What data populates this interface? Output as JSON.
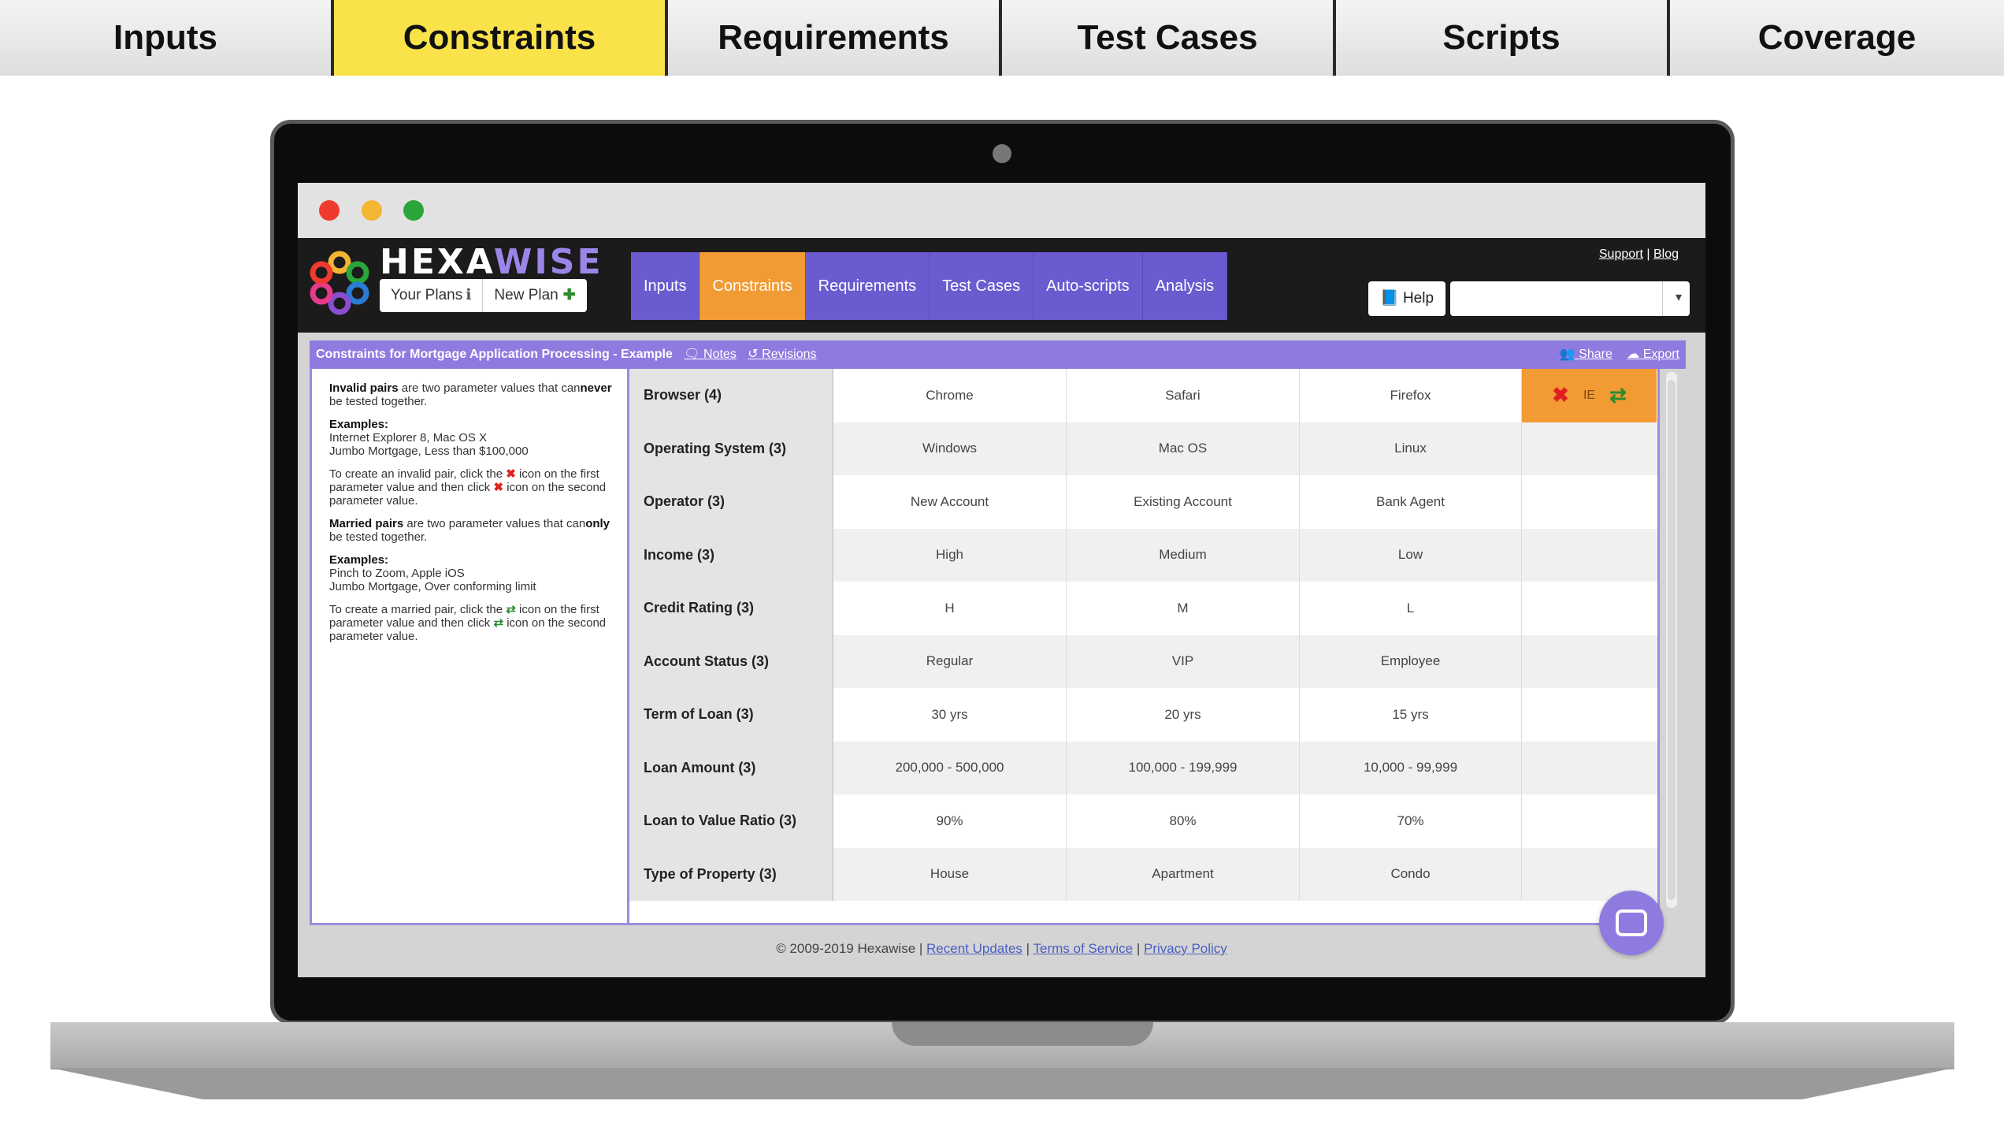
{
  "top_tabs": [
    {
      "label": "Inputs",
      "active": false
    },
    {
      "label": "Constraints",
      "active": true
    },
    {
      "label": "Requirements",
      "active": false
    },
    {
      "label": "Test Cases",
      "active": false
    },
    {
      "label": "Scripts",
      "active": false
    },
    {
      "label": "Coverage",
      "active": false
    }
  ],
  "app": {
    "brand_hexa": "HEXA",
    "brand_wise": "WISE",
    "your_plans": "Your Plans",
    "new_plan": "New Plan",
    "nav": [
      "Inputs",
      "Constraints",
      "Requirements",
      "Test Cases",
      "Auto-scripts",
      "Analysis"
    ],
    "support": "Support",
    "blog": "Blog",
    "help": "Help",
    "accent": "#6b5bd0",
    "active_color": "#f29a34"
  },
  "page": {
    "title": "Constraints for Mortgage Application Processing - Example",
    "notes": "Notes",
    "revisions": "Revisions",
    "share": "Share",
    "export": "Export"
  },
  "help_panel": {
    "invalid_bold": "Invalid pairs",
    "invalid_rest": "are two parameter values that can",
    "invalid_never": "never",
    "invalid_end": "be tested together.",
    "examples_label": "Examples:",
    "invalid_ex1": "Internet Explorer 8, Mac OS X",
    "invalid_ex2": "Jumbo Mortgage, Less than $100,000",
    "invalid_how1": "To create an invalid pair, click the",
    "invalid_how2": "icon on the first parameter value and then click",
    "invalid_how3": "icon on the second parameter value.",
    "married_bold": "Married pairs",
    "married_rest": "are two parameter values that can",
    "married_only": "only",
    "married_end": "be tested together.",
    "married_ex1": "Pinch to Zoom, Apple iOS",
    "married_ex2": "Jumbo Mortgage, Over conforming limit",
    "married_how1": "To create a married pair, click the",
    "married_how2": "icon on the first parameter value and then click",
    "married_how3": "icon on the second parameter value."
  },
  "params": [
    {
      "name": "Browser (4)",
      "values": [
        "Chrome",
        "Safari",
        "Firefox"
      ]
    },
    {
      "name": "Operating System (3)",
      "values": [
        "Windows",
        "Mac OS",
        "Linux"
      ]
    },
    {
      "name": "Operator (3)",
      "values": [
        "New Account",
        "Existing Account",
        "Bank Agent"
      ]
    },
    {
      "name": "Income (3)",
      "values": [
        "High",
        "Medium",
        "Low"
      ]
    },
    {
      "name": "Credit Rating (3)",
      "values": [
        "H",
        "M",
        "L"
      ]
    },
    {
      "name": "Account Status (3)",
      "values": [
        "Regular",
        "VIP",
        "Employee"
      ]
    },
    {
      "name": "Term of Loan (3)",
      "values": [
        "30 yrs",
        "20 yrs",
        "15 yrs"
      ]
    },
    {
      "name": "Loan Amount (3)",
      "values": [
        "200,000 - 500,000",
        "100,000 - 199,999",
        "10,000 - 99,999"
      ]
    },
    {
      "name": "Loan to Value Ratio (3)",
      "values": [
        "90%",
        "80%",
        "70%"
      ]
    },
    {
      "name": "Type of Property (3)",
      "values": [
        "House",
        "Apartment",
        "Condo"
      ]
    }
  ],
  "row_actions": {
    "ie": "IE"
  },
  "footer": {
    "copyright": "© 2009-2019 Hexawise |",
    "recent_updates": "Recent Updates",
    "terms": "Terms of Service",
    "privacy": "Privacy Policy",
    "sep": "|"
  }
}
